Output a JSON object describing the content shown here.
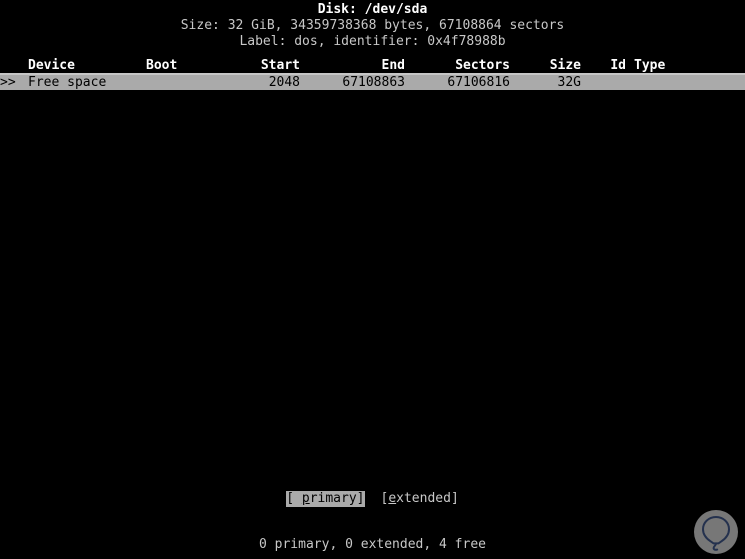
{
  "disk": {
    "title": "Disk: /dev/sda",
    "size_line": "Size: 32 GiB, 34359738368 bytes, 67108864 sectors",
    "label_line": "Label: dos, identifier: 0x4f78988b"
  },
  "table": {
    "columns": [
      {
        "key": "device",
        "label": "Device"
      },
      {
        "key": "boot",
        "label": "Boot"
      },
      {
        "key": "start",
        "label": "Start"
      },
      {
        "key": "end",
        "label": "End"
      },
      {
        "key": "sectors",
        "label": "Sectors"
      },
      {
        "key": "size",
        "label": "Size"
      },
      {
        "key": "id",
        "label": "Id"
      },
      {
        "key": "type",
        "label": "Type"
      }
    ],
    "rows": [
      {
        "marker": ">>",
        "device": "Free space",
        "boot": "",
        "start": "2048",
        "end": "67108863",
        "sectors": "67106816",
        "size": "32G",
        "id": "",
        "type": "",
        "selected": true
      }
    ]
  },
  "buttons": [
    {
      "prefix": "[ ",
      "hotkey": "p",
      "rest": "rimary]",
      "label": "[ primary]",
      "selected": true
    },
    {
      "prefix": "[",
      "hotkey": "e",
      "rest": "xtended]",
      "label": "[extended]",
      "selected": false
    }
  ],
  "status": {
    "summary": "0 primary, 0 extended, 4 free"
  },
  "watermark": {
    "name": "balloon-logo",
    "circle_color": "#8c8c8c",
    "stroke_color": "#2b3a5c"
  },
  "colors": {
    "background": "#000000",
    "foreground": "#c8c8c8",
    "bright": "#ffffff",
    "selection_bg": "#aaaaaa",
    "selection_fg": "#000000"
  }
}
